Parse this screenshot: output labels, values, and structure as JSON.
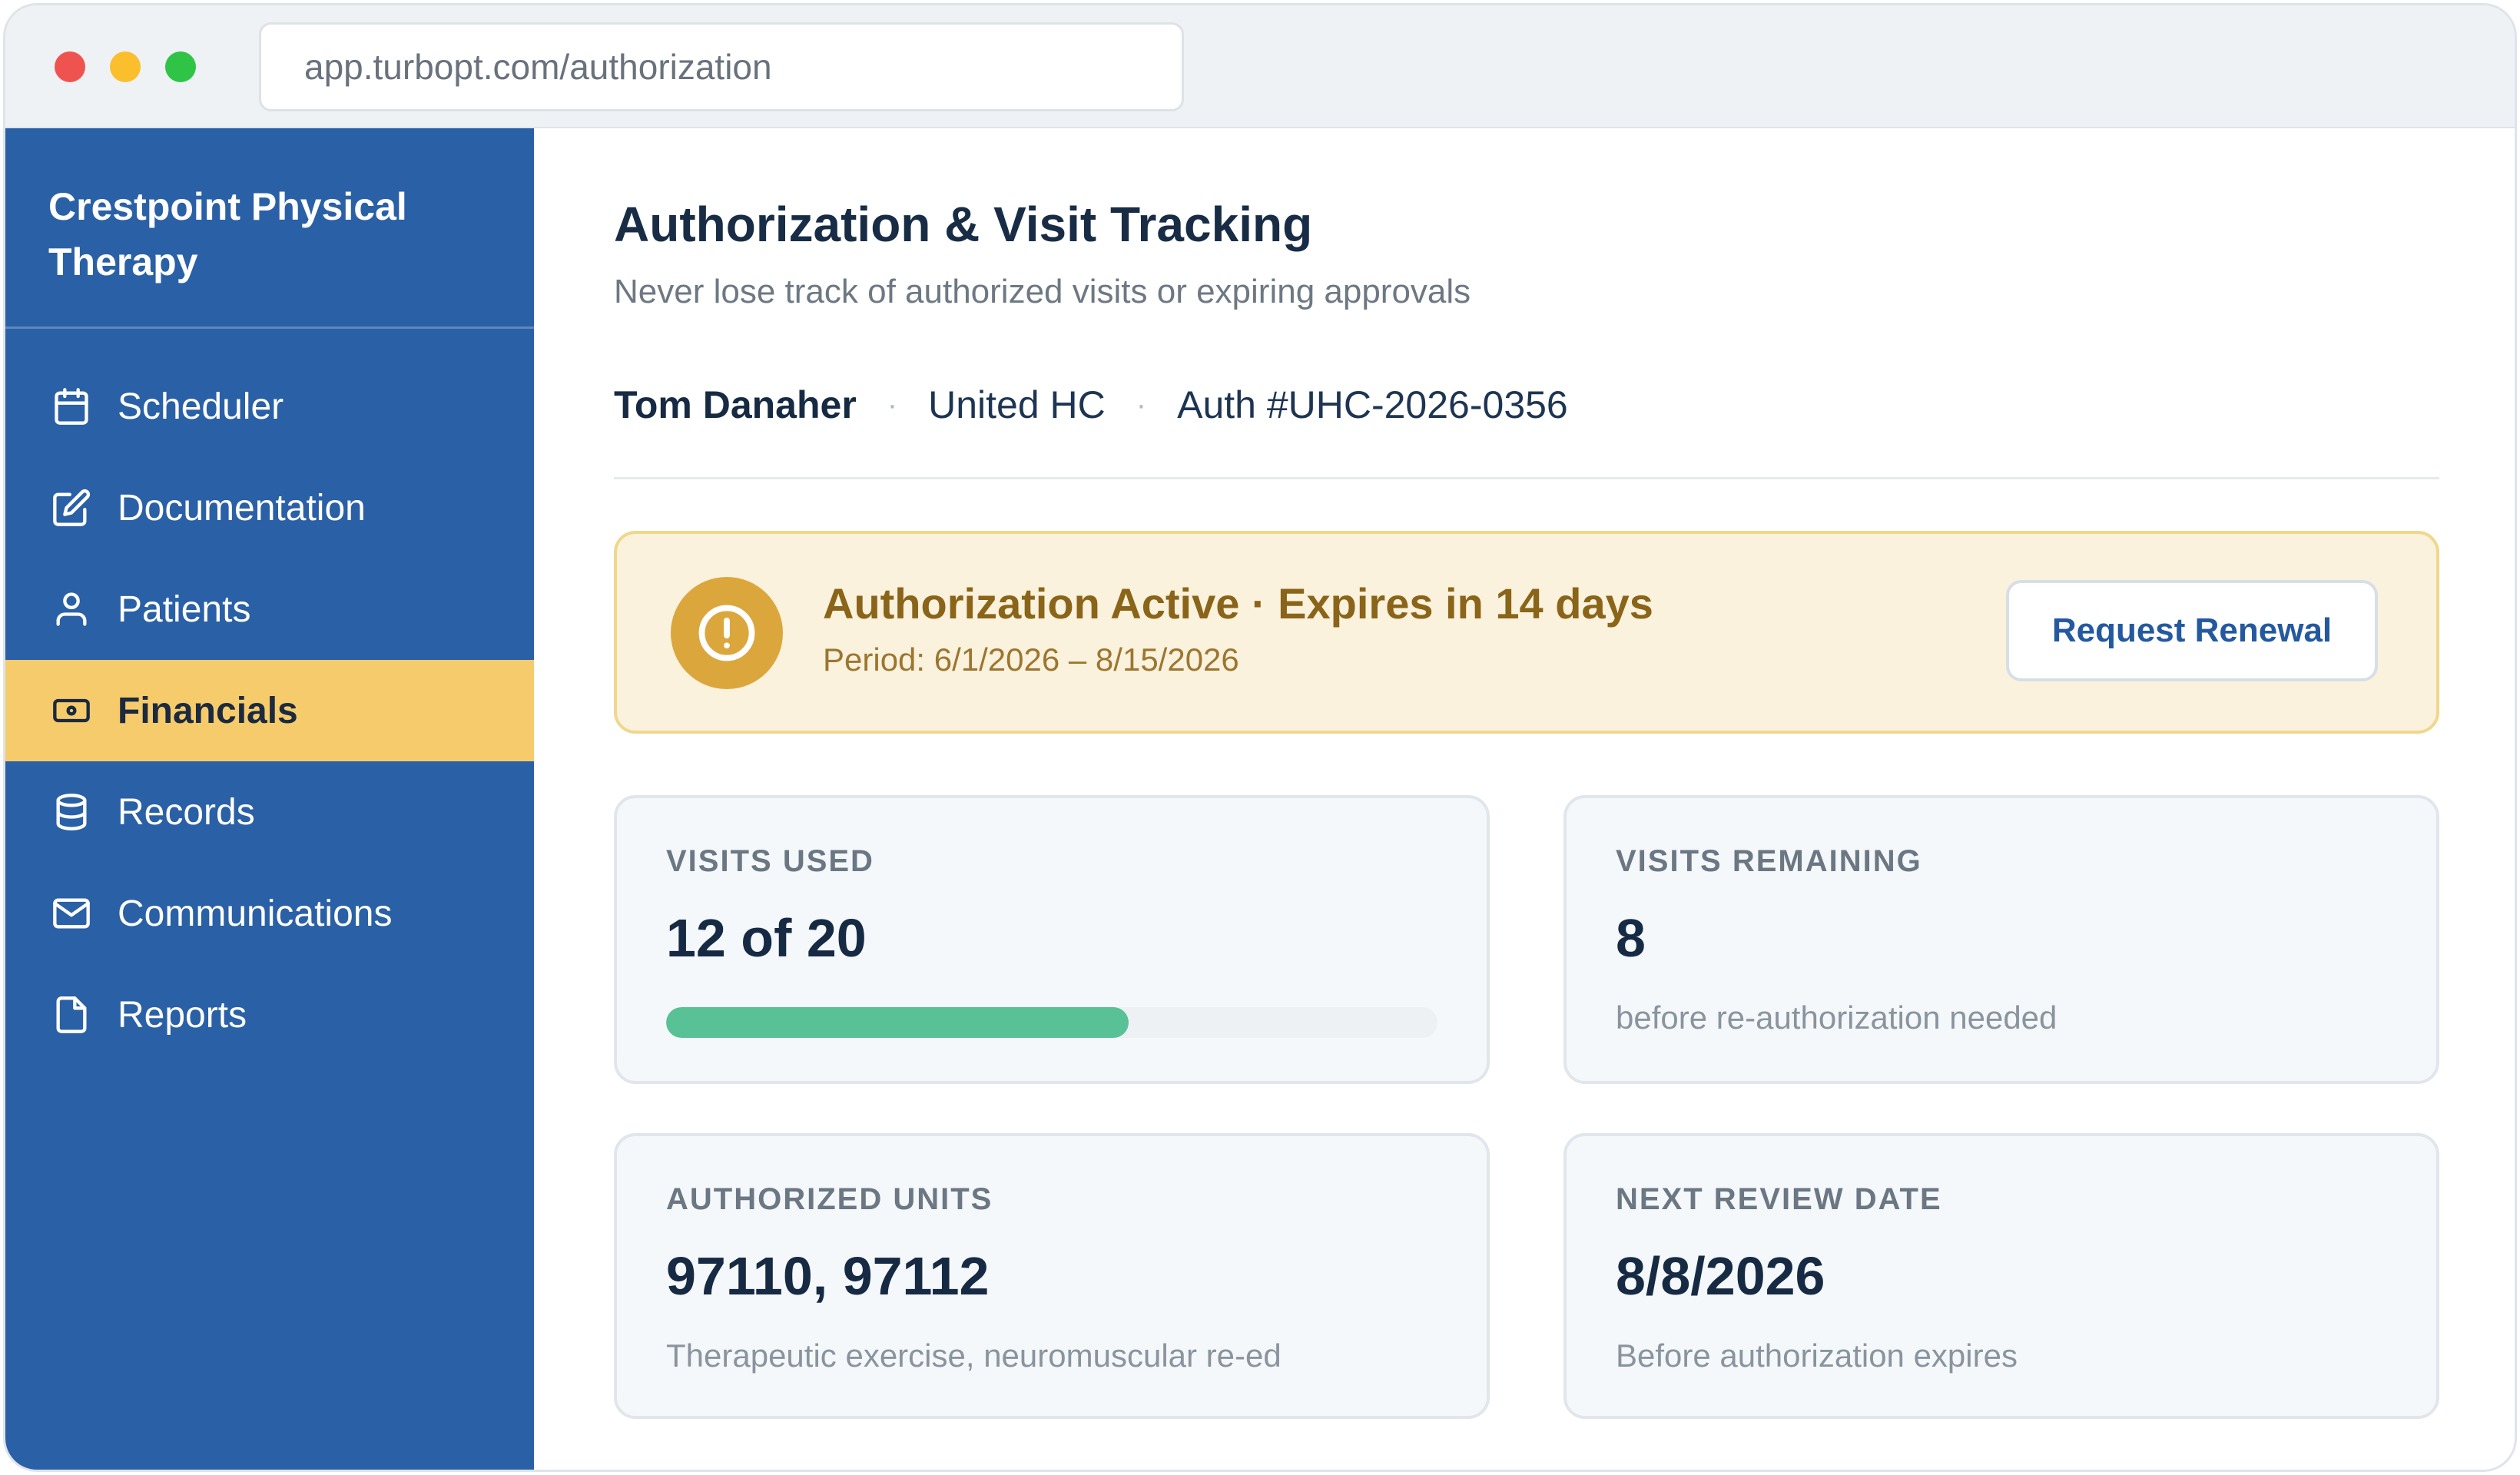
{
  "browser": {
    "url": "app.turbopt.com/authorization"
  },
  "sidebar": {
    "brand": "Crestpoint Physical Therapy",
    "items": [
      {
        "label": "Scheduler",
        "icon": "calendar-icon",
        "active": false
      },
      {
        "label": "Documentation",
        "icon": "edit-icon",
        "active": false
      },
      {
        "label": "Patients",
        "icon": "user-icon",
        "active": false
      },
      {
        "label": "Financials",
        "icon": "banknote-icon",
        "active": true
      },
      {
        "label": "Records",
        "icon": "database-icon",
        "active": false
      },
      {
        "label": "Communications",
        "icon": "mail-icon",
        "active": false
      },
      {
        "label": "Reports",
        "icon": "file-icon",
        "active": false
      }
    ]
  },
  "header": {
    "title": "Authorization & Visit Tracking",
    "subtitle": "Never lose track of authorized visits or expiring approvals"
  },
  "patient": {
    "name": "Tom Danaher",
    "payer": "United HC",
    "auth_number": "Auth #UHC-2026-0356",
    "separator": "·"
  },
  "alert": {
    "icon": "alert-circle-icon",
    "title": "Authorization Active · Expires in 14 days",
    "period": "Period: 6/1/2026 – 8/15/2026",
    "button_label": "Request Renewal"
  },
  "cards": {
    "visits_used": {
      "label": "VISITS USED",
      "value": "12 of 20",
      "progress_fraction": 0.6
    },
    "visits_remaining": {
      "label": "VISITS REMAINING",
      "value": "8",
      "note": "before re-authorization needed"
    },
    "authorized_units": {
      "label": "AUTHORIZED UNITS",
      "value": "97110, 97112",
      "note": "Therapeutic exercise, neuromuscular re-ed"
    },
    "next_review": {
      "label": "NEXT REVIEW DATE",
      "value": "8/8/2026",
      "note": "Before authorization expires"
    }
  },
  "colors": {
    "sidebar_bg": "#2a60a6",
    "active_nav_bg": "#f6cb6c",
    "alert_bg": "#fbf2dd",
    "alert_icon": "#dba73c",
    "progress": "#58c195"
  }
}
